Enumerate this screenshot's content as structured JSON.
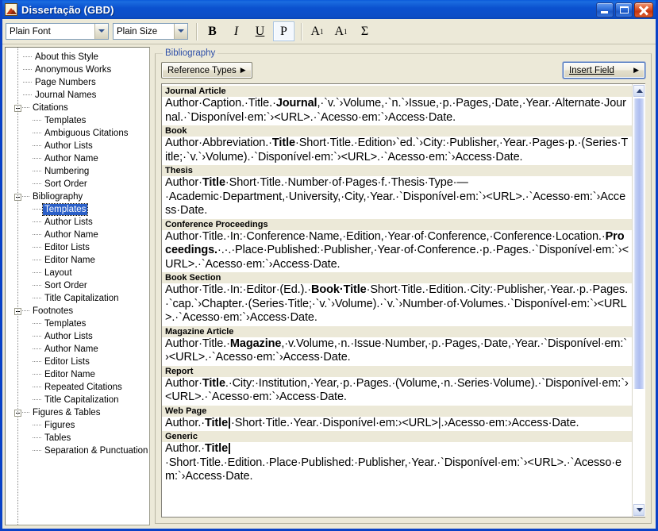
{
  "window": {
    "title": "Dissertação (GBD)",
    "icon": "style-document-icon",
    "controls": {
      "minimize": "Minimize",
      "maximize": "Maximize",
      "close": "Close"
    }
  },
  "toolbar": {
    "font_value": "Plain Font",
    "size_value": "Plain Size",
    "bold": "B",
    "italic": "I",
    "underline": "U",
    "plain": "P",
    "superscript": "A",
    "superscript_mark": "1",
    "subscript": "A",
    "subscript_mark": "1",
    "sigma": "Σ"
  },
  "sidebar": {
    "items": [
      {
        "label": "About this Style",
        "level": 1,
        "expander": false,
        "selected": false
      },
      {
        "label": "Anonymous Works",
        "level": 1,
        "expander": false,
        "selected": false
      },
      {
        "label": "Page Numbers",
        "level": 1,
        "expander": false,
        "selected": false
      },
      {
        "label": "Journal Names",
        "level": 1,
        "expander": false,
        "selected": false
      },
      {
        "label": "Citations",
        "level": 0,
        "expander": true,
        "selected": false
      },
      {
        "label": "Templates",
        "level": 2,
        "expander": false,
        "selected": false
      },
      {
        "label": "Ambiguous Citations",
        "level": 2,
        "expander": false,
        "selected": false
      },
      {
        "label": "Author Lists",
        "level": 2,
        "expander": false,
        "selected": false
      },
      {
        "label": "Author Name",
        "level": 2,
        "expander": false,
        "selected": false
      },
      {
        "label": "Numbering",
        "level": 2,
        "expander": false,
        "selected": false
      },
      {
        "label": "Sort Order",
        "level": 2,
        "expander": false,
        "selected": false
      },
      {
        "label": "Bibliography",
        "level": 0,
        "expander": true,
        "selected": false
      },
      {
        "label": "Templates",
        "level": 2,
        "expander": false,
        "selected": true
      },
      {
        "label": "Author Lists",
        "level": 2,
        "expander": false,
        "selected": false
      },
      {
        "label": "Author Name",
        "level": 2,
        "expander": false,
        "selected": false
      },
      {
        "label": "Editor Lists",
        "level": 2,
        "expander": false,
        "selected": false
      },
      {
        "label": "Editor Name",
        "level": 2,
        "expander": false,
        "selected": false
      },
      {
        "label": "Layout",
        "level": 2,
        "expander": false,
        "selected": false
      },
      {
        "label": "Sort Order",
        "level": 2,
        "expander": false,
        "selected": false
      },
      {
        "label": "Title Capitalization",
        "level": 2,
        "expander": false,
        "selected": false
      },
      {
        "label": "Footnotes",
        "level": 0,
        "expander": true,
        "selected": false
      },
      {
        "label": "Templates",
        "level": 2,
        "expander": false,
        "selected": false
      },
      {
        "label": "Author Lists",
        "level": 2,
        "expander": false,
        "selected": false
      },
      {
        "label": "Author Name",
        "level": 2,
        "expander": false,
        "selected": false
      },
      {
        "label": "Editor Lists",
        "level": 2,
        "expander": false,
        "selected": false
      },
      {
        "label": "Editor Name",
        "level": 2,
        "expander": false,
        "selected": false
      },
      {
        "label": "Repeated Citations",
        "level": 2,
        "expander": false,
        "selected": false
      },
      {
        "label": "Title Capitalization",
        "level": 2,
        "expander": false,
        "selected": false
      },
      {
        "label": "Figures & Tables",
        "level": 0,
        "expander": true,
        "selected": false
      },
      {
        "label": "Figures",
        "level": 2,
        "expander": false,
        "selected": false
      },
      {
        "label": "Tables",
        "level": 2,
        "expander": false,
        "selected": false
      },
      {
        "label": "Separation & Punctuation",
        "level": 2,
        "expander": false,
        "selected": false
      }
    ]
  },
  "main": {
    "group_legend": "Bibliography",
    "reference_types_button": "Reference Types",
    "reference_types_arrow": "▶",
    "insert_field_button": "Insert Field",
    "insert_field_arrow": "▶",
    "templates": [
      {
        "name": "Journal Article",
        "body": "Author·Caption.·Title.·**Journal**,·`v.`›Volume,·`n.`›Issue,·p.·Pages,·Date,·Year.·Alternate·Journal.·`Disponível·em:`›<URL>.·`Acesso·em:`›Access·Date."
      },
      {
        "name": "Book",
        "body": "Author·Abbreviation.·**Title**·Short·Title.·Edition›`ed.`›City:·Publisher,·Year.·Pages·p.·(Series·Title;·`v.`›Volume).·`Disponível·em:`›<URL>.·`Acesso·em:`›Access·Date."
      },
      {
        "name": "Thesis",
        "body": "Author·**Title**·Short·Title.·Number·of·Pages·f.·Thesis·Type·—·Academic·Department,·University,·City,·Year.·`Disponível·em:`›<URL>.·`Acesso·em:`›Access·Date."
      },
      {
        "name": "Conference Proceedings",
        "body": "Author·Title.·In:·Conference·Name,·Edition,·Year·of·Conference,·Conference·Location.·**Proceedings.**·.·.·Place·Published:·Publisher,·Year·of·Conference.·p.·Pages.·`Disponível·em:`›<URL>.·`Acesso·em:`›Access·Date."
      },
      {
        "name": "Book Section",
        "body": "Author·Title.·In:·Editor·(Ed.).·**Book·Title**·Short·Title.·Edition.·City:·Publisher,·Year.·p.·Pages.·`cap.`›Chapter.·(Series·Title;·`v.`›Volume).·`v.`›Number·of·Volumes.·`Disponível·em:`›<URL>.·`Acesso·em:`›Access·Date."
      },
      {
        "name": "Magazine Article",
        "body": "Author·Title.·**Magazine**,·v.Volume,·n.·Issue·Number,·p.·Pages,·Date,·Year.·`Disponível·em:`›<URL>.·`Acesso·em:`›Access·Date."
      },
      {
        "name": "Report",
        "body": "Author·**Title**.·City:·Institution,·Year,·p.·Pages.·(Volume,·n.·Series·Volume).·`Disponível·em:`›<URL>.·`Acesso·em:`›Access·Date."
      },
      {
        "name": "Web Page",
        "body": "Author.·**Title|**·Short·Title.·Year.·Disponível·em:›<URL>|.›Acesso·em:›Access·Date."
      },
      {
        "name": "Generic",
        "body": "Author.·**Title|**·Short·Title.·Edition.·Place·Published:·Publisher,·Year.·`Disponível·em:`›<URL>.·`Acesso·em:`›Access·Date."
      }
    ],
    "scrollbar": {
      "up_arrow": "▲",
      "down_arrow": "▼",
      "thumb_position_pct": 0,
      "thumb_size_pct": 72
    }
  },
  "colors": {
    "titlebar_blue": "#0b51cf",
    "window_border": "#0a42c6",
    "chrome": "#ece9d8",
    "selection_blue": "#2a5fc8",
    "legend_blue": "#2d4ea8",
    "close_red": "#c63510",
    "scroll_thumb": "#aebdf0"
  }
}
